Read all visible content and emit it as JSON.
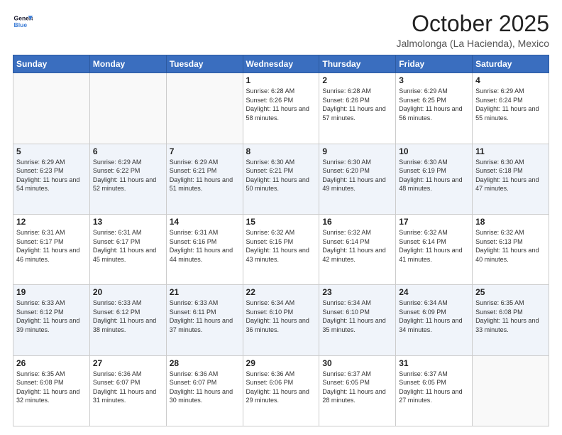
{
  "logo": {
    "line1": "General",
    "line2": "Blue"
  },
  "title": "October 2025",
  "location": "Jalmolonga (La Hacienda), Mexico",
  "days_of_week": [
    "Sunday",
    "Monday",
    "Tuesday",
    "Wednesday",
    "Thursday",
    "Friday",
    "Saturday"
  ],
  "weeks": [
    [
      {
        "day": "",
        "info": ""
      },
      {
        "day": "",
        "info": ""
      },
      {
        "day": "",
        "info": ""
      },
      {
        "day": "1",
        "sunrise": "6:28 AM",
        "sunset": "6:26 PM",
        "daylight": "11 hours and 58 minutes."
      },
      {
        "day": "2",
        "sunrise": "6:28 AM",
        "sunset": "6:26 PM",
        "daylight": "11 hours and 57 minutes."
      },
      {
        "day": "3",
        "sunrise": "6:29 AM",
        "sunset": "6:25 PM",
        "daylight": "11 hours and 56 minutes."
      },
      {
        "day": "4",
        "sunrise": "6:29 AM",
        "sunset": "6:24 PM",
        "daylight": "11 hours and 55 minutes."
      }
    ],
    [
      {
        "day": "5",
        "sunrise": "6:29 AM",
        "sunset": "6:23 PM",
        "daylight": "11 hours and 54 minutes."
      },
      {
        "day": "6",
        "sunrise": "6:29 AM",
        "sunset": "6:22 PM",
        "daylight": "11 hours and 52 minutes."
      },
      {
        "day": "7",
        "sunrise": "6:29 AM",
        "sunset": "6:21 PM",
        "daylight": "11 hours and 51 minutes."
      },
      {
        "day": "8",
        "sunrise": "6:30 AM",
        "sunset": "6:21 PM",
        "daylight": "11 hours and 50 minutes."
      },
      {
        "day": "9",
        "sunrise": "6:30 AM",
        "sunset": "6:20 PM",
        "daylight": "11 hours and 49 minutes."
      },
      {
        "day": "10",
        "sunrise": "6:30 AM",
        "sunset": "6:19 PM",
        "daylight": "11 hours and 48 minutes."
      },
      {
        "day": "11",
        "sunrise": "6:30 AM",
        "sunset": "6:18 PM",
        "daylight": "11 hours and 47 minutes."
      }
    ],
    [
      {
        "day": "12",
        "sunrise": "6:31 AM",
        "sunset": "6:17 PM",
        "daylight": "11 hours and 46 minutes."
      },
      {
        "day": "13",
        "sunrise": "6:31 AM",
        "sunset": "6:17 PM",
        "daylight": "11 hours and 45 minutes."
      },
      {
        "day": "14",
        "sunrise": "6:31 AM",
        "sunset": "6:16 PM",
        "daylight": "11 hours and 44 minutes."
      },
      {
        "day": "15",
        "sunrise": "6:32 AM",
        "sunset": "6:15 PM",
        "daylight": "11 hours and 43 minutes."
      },
      {
        "day": "16",
        "sunrise": "6:32 AM",
        "sunset": "6:14 PM",
        "daylight": "11 hours and 42 minutes."
      },
      {
        "day": "17",
        "sunrise": "6:32 AM",
        "sunset": "6:14 PM",
        "daylight": "11 hours and 41 minutes."
      },
      {
        "day": "18",
        "sunrise": "6:32 AM",
        "sunset": "6:13 PM",
        "daylight": "11 hours and 40 minutes."
      }
    ],
    [
      {
        "day": "19",
        "sunrise": "6:33 AM",
        "sunset": "6:12 PM",
        "daylight": "11 hours and 39 minutes."
      },
      {
        "day": "20",
        "sunrise": "6:33 AM",
        "sunset": "6:12 PM",
        "daylight": "11 hours and 38 minutes."
      },
      {
        "day": "21",
        "sunrise": "6:33 AM",
        "sunset": "6:11 PM",
        "daylight": "11 hours and 37 minutes."
      },
      {
        "day": "22",
        "sunrise": "6:34 AM",
        "sunset": "6:10 PM",
        "daylight": "11 hours and 36 minutes."
      },
      {
        "day": "23",
        "sunrise": "6:34 AM",
        "sunset": "6:10 PM",
        "daylight": "11 hours and 35 minutes."
      },
      {
        "day": "24",
        "sunrise": "6:34 AM",
        "sunset": "6:09 PM",
        "daylight": "11 hours and 34 minutes."
      },
      {
        "day": "25",
        "sunrise": "6:35 AM",
        "sunset": "6:08 PM",
        "daylight": "11 hours and 33 minutes."
      }
    ],
    [
      {
        "day": "26",
        "sunrise": "6:35 AM",
        "sunset": "6:08 PM",
        "daylight": "11 hours and 32 minutes."
      },
      {
        "day": "27",
        "sunrise": "6:36 AM",
        "sunset": "6:07 PM",
        "daylight": "11 hours and 31 minutes."
      },
      {
        "day": "28",
        "sunrise": "6:36 AM",
        "sunset": "6:07 PM",
        "daylight": "11 hours and 30 minutes."
      },
      {
        "day": "29",
        "sunrise": "6:36 AM",
        "sunset": "6:06 PM",
        "daylight": "11 hours and 29 minutes."
      },
      {
        "day": "30",
        "sunrise": "6:37 AM",
        "sunset": "6:05 PM",
        "daylight": "11 hours and 28 minutes."
      },
      {
        "day": "31",
        "sunrise": "6:37 AM",
        "sunset": "6:05 PM",
        "daylight": "11 hours and 27 minutes."
      },
      {
        "day": "",
        "info": ""
      }
    ]
  ]
}
